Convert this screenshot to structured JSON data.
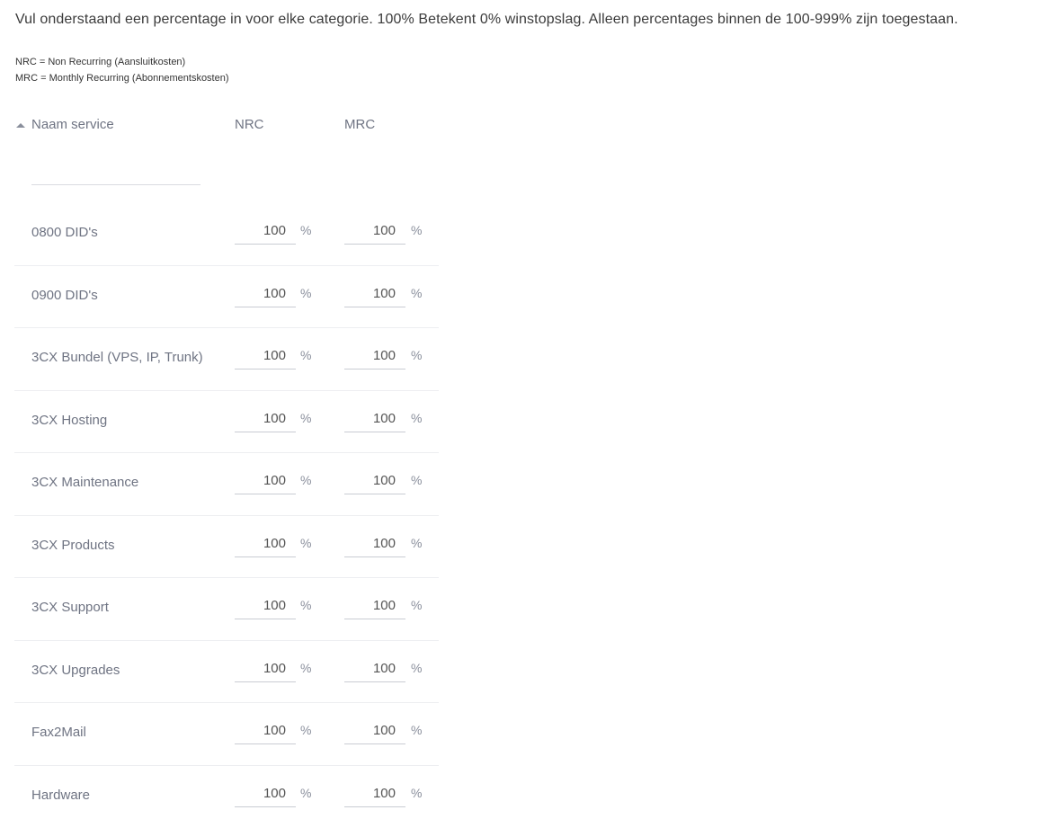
{
  "intro": "Vul onderstaand een percentage in voor elke categorie. 100% Betekent 0% winstopslag. Alleen percentages binnen de 100-999% zijn toegestaan.",
  "legend": {
    "nrc": "NRC = Non Recurring (Aansluitkosten)",
    "mrc": "MRC = Monthly Recurring (Abonnementskosten)"
  },
  "table": {
    "headers": {
      "name": "Naam service",
      "nrc": "NRC",
      "mrc": "MRC"
    },
    "sort_icon": "sort-asc-icon",
    "filter": {
      "value": "",
      "placeholder": ""
    },
    "unit": "%",
    "rows": [
      {
        "name": "0800 DID's",
        "nrc": "100",
        "mrc": "100"
      },
      {
        "name": "0900 DID's",
        "nrc": "100",
        "mrc": "100"
      },
      {
        "name": "3CX Bundel (VPS, IP, Trunk)",
        "nrc": "100",
        "mrc": "100"
      },
      {
        "name": "3CX Hosting",
        "nrc": "100",
        "mrc": "100"
      },
      {
        "name": "3CX Maintenance",
        "nrc": "100",
        "mrc": "100"
      },
      {
        "name": "3CX Products",
        "nrc": "100",
        "mrc": "100"
      },
      {
        "name": "3CX Support",
        "nrc": "100",
        "mrc": "100"
      },
      {
        "name": "3CX Upgrades",
        "nrc": "100",
        "mrc": "100"
      },
      {
        "name": "Fax2Mail",
        "nrc": "100",
        "mrc": "100"
      },
      {
        "name": "Hardware",
        "nrc": "100",
        "mrc": "100"
      }
    ]
  }
}
